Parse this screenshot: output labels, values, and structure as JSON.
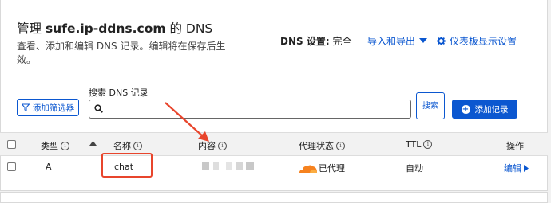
{
  "header": {
    "title_prefix": "管理",
    "domain": "sufe.ip-ddns.com",
    "title_suffix": "的 DNS",
    "description": "查看、添加和编辑 DNS 记录。编辑将在保存后生效。",
    "dns_setting_label": "DNS 设置:",
    "dns_setting_value": "完全",
    "import_export": "导入和导出",
    "dashboard_settings": "仪表板显示设置"
  },
  "toolbar": {
    "filter_button": "添加筛选器",
    "search_label": "搜索 DNS 记录",
    "search_value": "",
    "search_button": "搜索",
    "add_record": "添加记录"
  },
  "table": {
    "columns": {
      "type": "类型",
      "name": "名称",
      "content": "内容",
      "proxy": "代理状态",
      "ttl": "TTL",
      "actions": "操作"
    },
    "rows": [
      {
        "type": "A",
        "name": "chat",
        "proxy": "已代理",
        "ttl": "自动",
        "action": "编辑"
      }
    ]
  },
  "colors": {
    "accent": "#0b57d0",
    "annotation": "#e8452c",
    "proxy_cloud": "#f6821f"
  }
}
